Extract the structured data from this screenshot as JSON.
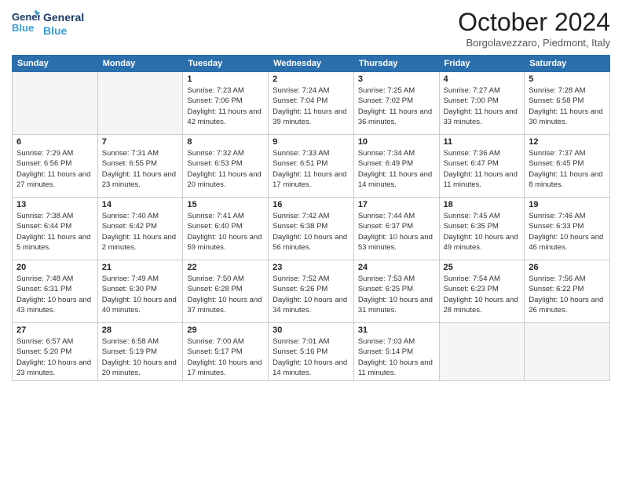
{
  "header": {
    "logo_line1": "General",
    "logo_line2": "Blue",
    "title": "October 2024",
    "location": "Borgolavezzaro, Piedmont, Italy"
  },
  "days_of_week": [
    "Sunday",
    "Monday",
    "Tuesday",
    "Wednesday",
    "Thursday",
    "Friday",
    "Saturday"
  ],
  "weeks": [
    [
      {
        "day": "",
        "info": ""
      },
      {
        "day": "",
        "info": ""
      },
      {
        "day": "1",
        "info": "Sunrise: 7:23 AM\nSunset: 7:06 PM\nDaylight: 11 hours and 42 minutes."
      },
      {
        "day": "2",
        "info": "Sunrise: 7:24 AM\nSunset: 7:04 PM\nDaylight: 11 hours and 39 minutes."
      },
      {
        "day": "3",
        "info": "Sunrise: 7:25 AM\nSunset: 7:02 PM\nDaylight: 11 hours and 36 minutes."
      },
      {
        "day": "4",
        "info": "Sunrise: 7:27 AM\nSunset: 7:00 PM\nDaylight: 11 hours and 33 minutes."
      },
      {
        "day": "5",
        "info": "Sunrise: 7:28 AM\nSunset: 6:58 PM\nDaylight: 11 hours and 30 minutes."
      }
    ],
    [
      {
        "day": "6",
        "info": "Sunrise: 7:29 AM\nSunset: 6:56 PM\nDaylight: 11 hours and 27 minutes."
      },
      {
        "day": "7",
        "info": "Sunrise: 7:31 AM\nSunset: 6:55 PM\nDaylight: 11 hours and 23 minutes."
      },
      {
        "day": "8",
        "info": "Sunrise: 7:32 AM\nSunset: 6:53 PM\nDaylight: 11 hours and 20 minutes."
      },
      {
        "day": "9",
        "info": "Sunrise: 7:33 AM\nSunset: 6:51 PM\nDaylight: 11 hours and 17 minutes."
      },
      {
        "day": "10",
        "info": "Sunrise: 7:34 AM\nSunset: 6:49 PM\nDaylight: 11 hours and 14 minutes."
      },
      {
        "day": "11",
        "info": "Sunrise: 7:36 AM\nSunset: 6:47 PM\nDaylight: 11 hours and 11 minutes."
      },
      {
        "day": "12",
        "info": "Sunrise: 7:37 AM\nSunset: 6:45 PM\nDaylight: 11 hours and 8 minutes."
      }
    ],
    [
      {
        "day": "13",
        "info": "Sunrise: 7:38 AM\nSunset: 6:44 PM\nDaylight: 11 hours and 5 minutes."
      },
      {
        "day": "14",
        "info": "Sunrise: 7:40 AM\nSunset: 6:42 PM\nDaylight: 11 hours and 2 minutes."
      },
      {
        "day": "15",
        "info": "Sunrise: 7:41 AM\nSunset: 6:40 PM\nDaylight: 10 hours and 59 minutes."
      },
      {
        "day": "16",
        "info": "Sunrise: 7:42 AM\nSunset: 6:38 PM\nDaylight: 10 hours and 56 minutes."
      },
      {
        "day": "17",
        "info": "Sunrise: 7:44 AM\nSunset: 6:37 PM\nDaylight: 10 hours and 53 minutes."
      },
      {
        "day": "18",
        "info": "Sunrise: 7:45 AM\nSunset: 6:35 PM\nDaylight: 10 hours and 49 minutes."
      },
      {
        "day": "19",
        "info": "Sunrise: 7:46 AM\nSunset: 6:33 PM\nDaylight: 10 hours and 46 minutes."
      }
    ],
    [
      {
        "day": "20",
        "info": "Sunrise: 7:48 AM\nSunset: 6:31 PM\nDaylight: 10 hours and 43 minutes."
      },
      {
        "day": "21",
        "info": "Sunrise: 7:49 AM\nSunset: 6:30 PM\nDaylight: 10 hours and 40 minutes."
      },
      {
        "day": "22",
        "info": "Sunrise: 7:50 AM\nSunset: 6:28 PM\nDaylight: 10 hours and 37 minutes."
      },
      {
        "day": "23",
        "info": "Sunrise: 7:52 AM\nSunset: 6:26 PM\nDaylight: 10 hours and 34 minutes."
      },
      {
        "day": "24",
        "info": "Sunrise: 7:53 AM\nSunset: 6:25 PM\nDaylight: 10 hours and 31 minutes."
      },
      {
        "day": "25",
        "info": "Sunrise: 7:54 AM\nSunset: 6:23 PM\nDaylight: 10 hours and 28 minutes."
      },
      {
        "day": "26",
        "info": "Sunrise: 7:56 AM\nSunset: 6:22 PM\nDaylight: 10 hours and 26 minutes."
      }
    ],
    [
      {
        "day": "27",
        "info": "Sunrise: 6:57 AM\nSunset: 5:20 PM\nDaylight: 10 hours and 23 minutes."
      },
      {
        "day": "28",
        "info": "Sunrise: 6:58 AM\nSunset: 5:19 PM\nDaylight: 10 hours and 20 minutes."
      },
      {
        "day": "29",
        "info": "Sunrise: 7:00 AM\nSunset: 5:17 PM\nDaylight: 10 hours and 17 minutes."
      },
      {
        "day": "30",
        "info": "Sunrise: 7:01 AM\nSunset: 5:16 PM\nDaylight: 10 hours and 14 minutes."
      },
      {
        "day": "31",
        "info": "Sunrise: 7:03 AM\nSunset: 5:14 PM\nDaylight: 10 hours and 11 minutes."
      },
      {
        "day": "",
        "info": ""
      },
      {
        "day": "",
        "info": ""
      }
    ]
  ]
}
